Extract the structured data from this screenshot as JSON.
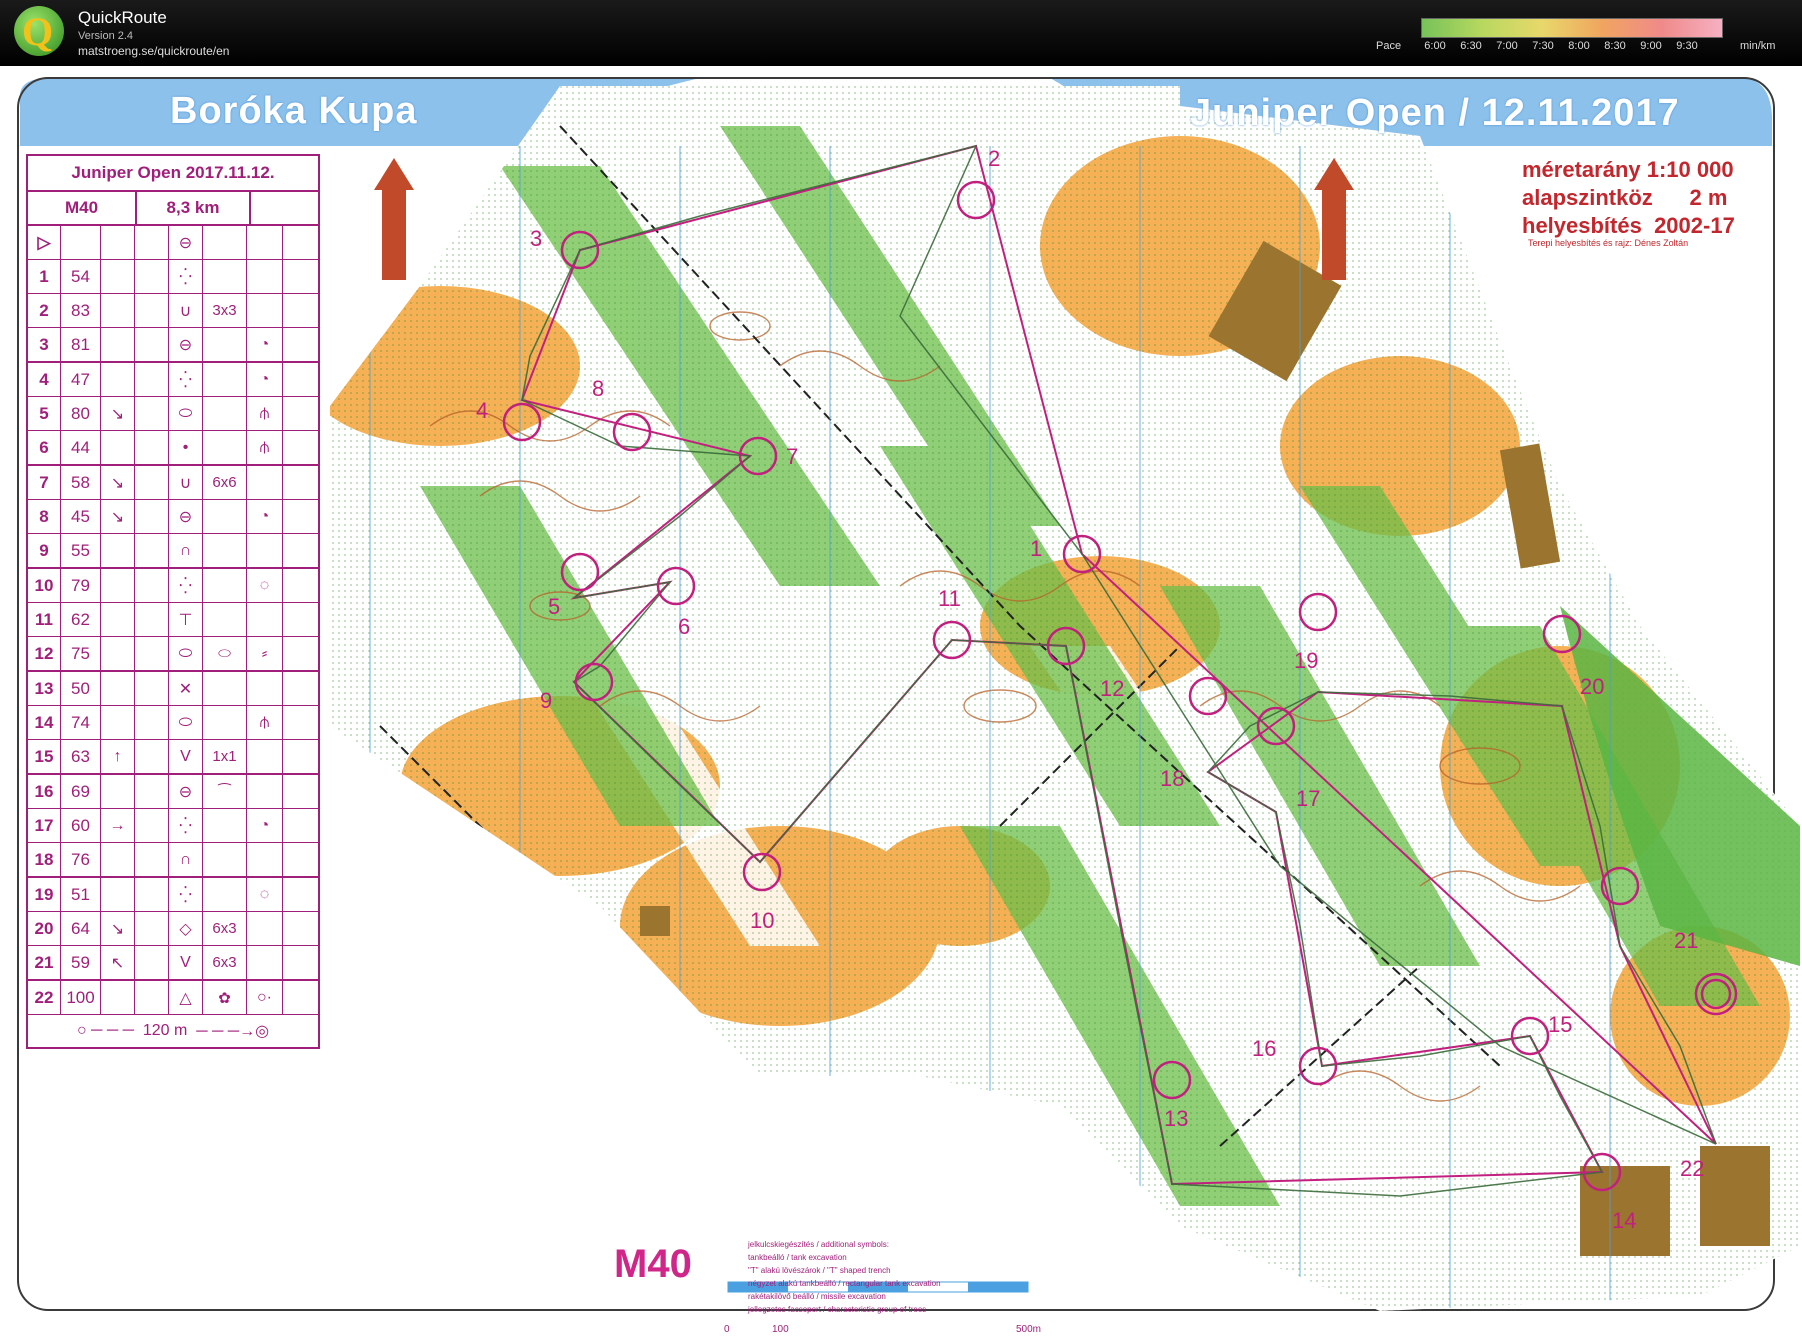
{
  "app": {
    "title": "QuickRoute",
    "version": "Version 2.4",
    "url": "matstroeng.se/quickroute/en",
    "logo_letter": "Q"
  },
  "pace_legend": {
    "label": "Pace",
    "ticks": [
      "6:00",
      "6:30",
      "7:00",
      "7:30",
      "8:00",
      "8:30",
      "9:00",
      "9:30"
    ],
    "unit": "min/km"
  },
  "map": {
    "title_left": "Boróka Kupa",
    "title_right": "Juniper Open / 12.11.2017",
    "scale_lines": [
      "méretarány 1:10 000",
      "alapszintköz      2 m",
      "helyesbítés  2002-17"
    ],
    "credit": "Terepi helyesbítés és rajz: Dénes Zoltán",
    "class_label": "M40",
    "legend_lines": [
      "jelkulcskiegészítés / additional symbols:",
      "tankbeálló / tank excavation",
      "\"T\" alakú lövészárok / \"T\" shaped trench",
      "négyzet alakú tankbeálló / rectangular tank excavation",
      "rakétakilövő beálló / missile excavation",
      "jellegzetes facsoport / characteristic group of trees"
    ],
    "scale_bar": [
      "0",
      "100",
      "500m"
    ],
    "control_numbers": [
      "1",
      "2",
      "3",
      "4",
      "5",
      "6",
      "7",
      "8",
      "9",
      "10",
      "11",
      "12",
      "13",
      "14",
      "15",
      "16",
      "17",
      "18",
      "19",
      "20",
      "21",
      "22"
    ]
  },
  "control_description": {
    "event": "Juniper Open 2017.11.12.",
    "class": "M40",
    "length": "8,3 km",
    "rows": [
      {
        "n": "1",
        "code": "54",
        "dir": "",
        "feat": "⁛",
        "dim": "",
        "extra": ""
      },
      {
        "n": "2",
        "code": "83",
        "dir": "",
        "feat": "∪",
        "dim": "3x3",
        "extra": ""
      },
      {
        "n": "3",
        "code": "81",
        "dir": "",
        "feat": "⊖",
        "dim": "",
        "extra": "◔"
      },
      {
        "n": "4",
        "code": "47",
        "dir": "",
        "feat": "⁛",
        "dim": "",
        "extra": "◔"
      },
      {
        "n": "5",
        "code": "80",
        "dir": "↘",
        "feat": "⬭",
        "dim": "",
        "extra": "⫛"
      },
      {
        "n": "6",
        "code": "44",
        "dir": "",
        "feat": "•",
        "dim": "",
        "extra": "⫛"
      },
      {
        "n": "7",
        "code": "58",
        "dir": "↘",
        "feat": "∪",
        "dim": "6x6",
        "extra": ""
      },
      {
        "n": "8",
        "code": "45",
        "dir": "↘",
        "feat": "⊖",
        "dim": "",
        "extra": "◔"
      },
      {
        "n": "9",
        "code": "55",
        "dir": "",
        "feat": "∩",
        "dim": "",
        "extra": ""
      },
      {
        "n": "10",
        "code": "79",
        "dir": "",
        "feat": "⁛",
        "dim": "",
        "extra": "◌"
      },
      {
        "n": "11",
        "code": "62",
        "dir": "",
        "feat": "⊤",
        "dim": "",
        "extra": ""
      },
      {
        "n": "12",
        "code": "75",
        "dir": "",
        "feat": "⬭",
        "dim": "⬭",
        "extra": "⸗"
      },
      {
        "n": "13",
        "code": "50",
        "dir": "",
        "feat": "✕",
        "dim": "",
        "extra": ""
      },
      {
        "n": "14",
        "code": "74",
        "dir": "",
        "feat": "⬭",
        "dim": "",
        "extra": "⫛"
      },
      {
        "n": "15",
        "code": "63",
        "dir": "↑",
        "feat": "V",
        "dim": "1x1",
        "extra": ""
      },
      {
        "n": "16",
        "code": "69",
        "dir": "",
        "feat": "⊖",
        "dim": "⁀",
        "extra": ""
      },
      {
        "n": "17",
        "code": "60",
        "dir": "→",
        "feat": "⁛",
        "dim": "",
        "extra": "◔"
      },
      {
        "n": "18",
        "code": "76",
        "dir": "",
        "feat": "∩",
        "dim": "",
        "extra": ""
      },
      {
        "n": "19",
        "code": "51",
        "dir": "",
        "feat": "⁛",
        "dim": "",
        "extra": "◌"
      },
      {
        "n": "20",
        "code": "64",
        "dir": "↘",
        "feat": "◇",
        "dim": "6x3",
        "extra": ""
      },
      {
        "n": "21",
        "code": "59",
        "dir": "↖",
        "feat": "V",
        "dim": "6x3",
        "extra": ""
      },
      {
        "n": "22",
        "code": "100",
        "dir": "",
        "feat": "△",
        "dim": "✿",
        "extra": "○·"
      }
    ],
    "footer": "120 m",
    "colors": {
      "magenta": "#a01f7a"
    }
  },
  "colors": {
    "open_land": "#f5a742",
    "forest_green": "#6cbf4a",
    "contour_brown": "#b8612a",
    "course_magenta": "#c2207f",
    "route_dark": "#3b3b3b",
    "header_blue": "#8cc1ec",
    "title_red": "#c2272d"
  }
}
